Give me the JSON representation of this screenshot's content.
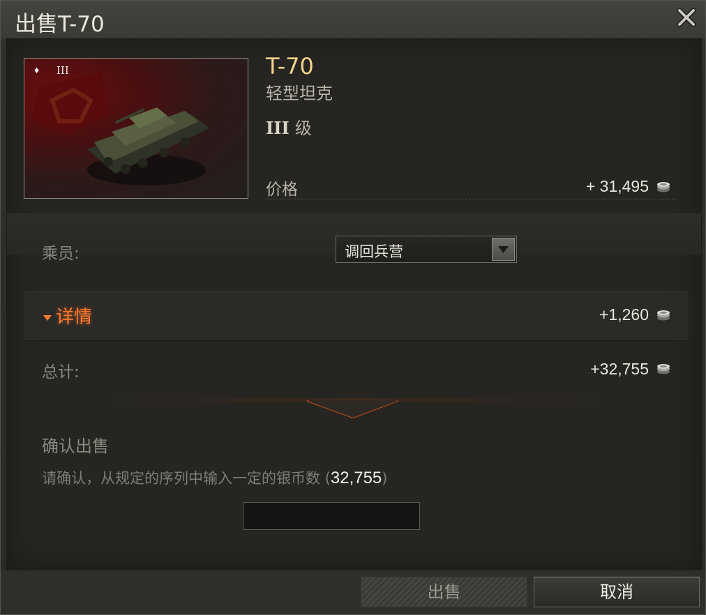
{
  "window": {
    "title": "出售T-70"
  },
  "vehicle": {
    "name": "T-70",
    "type": "轻型坦克",
    "tier_roman": "III",
    "tier_suffix": "级",
    "preview_tier": "III",
    "price_label": "价格",
    "price_value": "+ 31,495"
  },
  "crew": {
    "label": "乘员:",
    "selected": "调回兵营"
  },
  "details": {
    "label": "详情",
    "value": "+1,260"
  },
  "total": {
    "label": "总计:",
    "value": "+32,755"
  },
  "confirm": {
    "title": "确认出售",
    "text": "请确认，从规定的序列中输入一定的银币数 (",
    "number": "32,755",
    "text_end": ")",
    "input_value": ""
  },
  "buttons": {
    "sell": "出售",
    "cancel": "取消"
  },
  "colors": {
    "accent_orange": "#ff7a2e",
    "vehicle_name": "#f2d38a"
  },
  "icons": {
    "close": "close-icon",
    "coin": "silver-coin-icon",
    "dropdown": "chevron-down-icon",
    "rank": "rank-diamond-icon"
  }
}
